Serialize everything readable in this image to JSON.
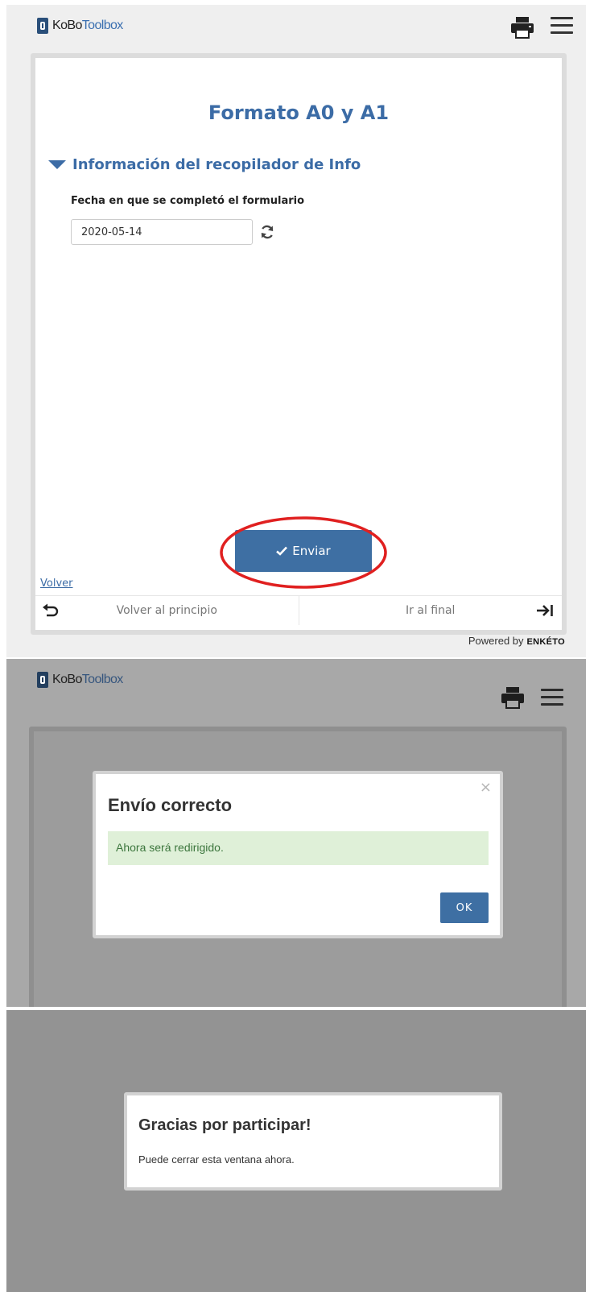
{
  "brand": {
    "part1": "KoBo",
    "part2": "Toolbox"
  },
  "form": {
    "title": "Formato A0 y A1",
    "group_title": "Información del recopilador de Info",
    "question_label": "Fecha en que se completó el formulario",
    "date_value": "2020-05-14",
    "submit_label": "Enviar",
    "back_link": "Volver",
    "nav_start": "Volver al principio",
    "nav_end": "Ir al final",
    "powered_by": "Powered by",
    "powered_brand": "ENKÉTO"
  },
  "success_dialog": {
    "title": "Envío correcto",
    "message": "Ahora será redirigido.",
    "ok_label": "OK",
    "close_symbol": "×"
  },
  "thanks_dialog": {
    "title": "Gracias por participar!",
    "message": "Puede cerrar esta ventana ahora."
  },
  "colors": {
    "accent": "#3c6ca6",
    "button": "#3e6fa3",
    "success_bg": "#dff0d8",
    "success_text": "#3c763d",
    "highlight": "#e02020"
  },
  "icons": [
    "print-icon",
    "menu-icon",
    "refresh-icon",
    "check-icon",
    "undo-arrow-icon",
    "go-to-end-icon",
    "close-icon"
  ]
}
